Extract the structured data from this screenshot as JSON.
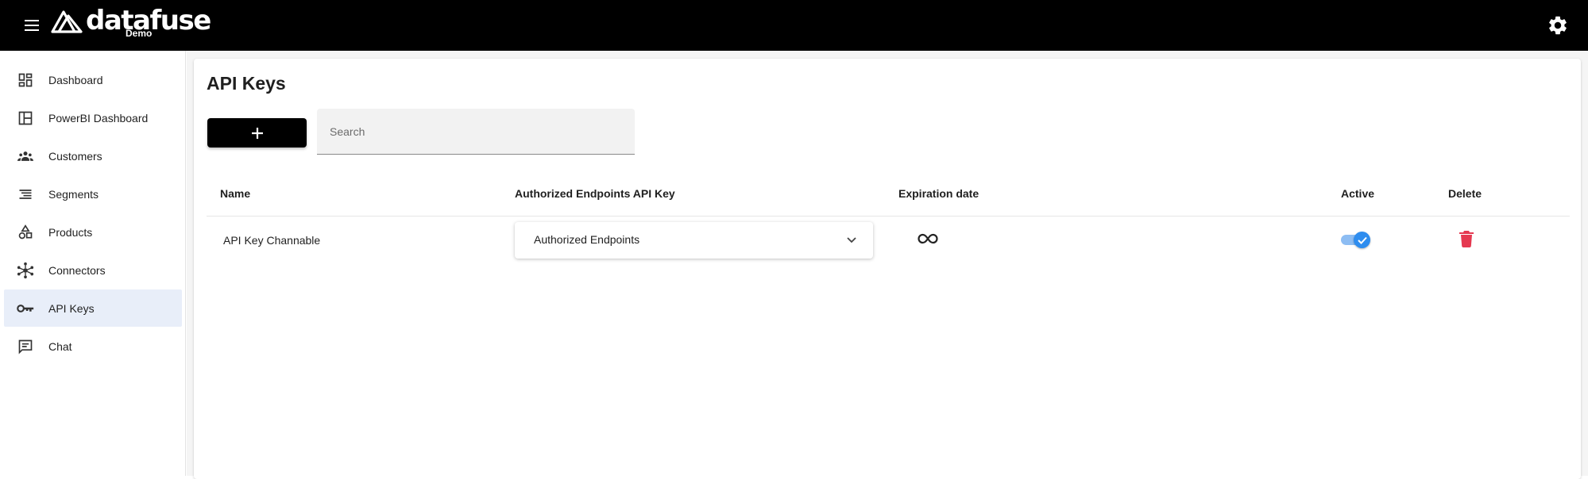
{
  "app": {
    "brand": "datafuse",
    "brand_sub": "Demo"
  },
  "sidebar": {
    "items": [
      {
        "label": "Dashboard",
        "icon": "dashboard-icon"
      },
      {
        "label": "PowerBI Dashboard",
        "icon": "powerbi-dashboard-icon"
      },
      {
        "label": "Customers",
        "icon": "customers-icon"
      },
      {
        "label": "Segments",
        "icon": "segments-icon"
      },
      {
        "label": "Products",
        "icon": "products-icon"
      },
      {
        "label": "Connectors",
        "icon": "connectors-icon"
      },
      {
        "label": "API Keys",
        "icon": "key-icon",
        "active": true
      },
      {
        "label": "Chat",
        "icon": "chat-icon"
      }
    ]
  },
  "page": {
    "title": "API Keys",
    "add_button_icon": "plus-icon",
    "search": {
      "placeholder": "Search",
      "value": ""
    }
  },
  "table": {
    "columns": [
      "Name",
      "Authorized Endpoints API Key",
      "Expiration date",
      "Active",
      "Delete"
    ],
    "rows": [
      {
        "name": "API Key Channable",
        "endpoints": "Authorized Endpoints",
        "expiration": "infinity-icon",
        "active": true
      }
    ]
  },
  "colors": {
    "topbar": "#000000",
    "accent": "#2e8def",
    "active_nav": "#e8eef9",
    "delete": "#e53950"
  }
}
